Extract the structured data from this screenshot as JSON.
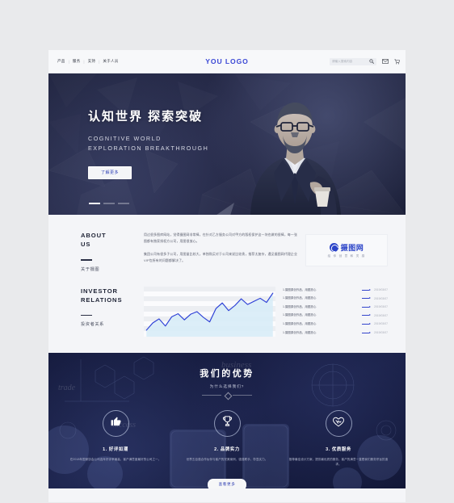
{
  "nav": {
    "links": [
      "产品",
      "服务",
      "支持",
      "关于人员"
    ],
    "logo": "YOU LOGO",
    "search_placeholder": "请输入搜索内容",
    "icons": {
      "search": "search-icon",
      "mail": "mail-icon",
      "cart": "cart-icon"
    }
  },
  "hero": {
    "title_cn": "认知世界 探索突破",
    "title_en_line1": "COGNITIVE WORLD",
    "title_en_line2": "EXPLORATION BREAKTHROUGH",
    "button": "了解更多",
    "slides": 3,
    "active_slide": 1
  },
  "about": {
    "title_en_line1": "ABOUT",
    "title_en_line2": "US",
    "title_cn": "关于摄图",
    "paragraph1": "用过很多图库网站，觉得摄图网非常棒，在针对乙方服务公司对甲方的版权保护这一块也做的很棒，每一张图都有独家授权方公司，用图很放心。",
    "paragraph2": "集团公司有很多子公司，用图量比较大，单独购买对于公司来说比较贵，推荐太复杂，遇见摄图网代理企业VIP包所有的问题都解决了。",
    "watermark": {
      "name": "摄图网",
      "tagline": "给 你 创 意 和 灵 感"
    }
  },
  "investor": {
    "title_en_line1": "INVESTOR",
    "title_en_line2": "RELATIONS",
    "title_cn": "投资者关系",
    "chart_data": {
      "type": "line",
      "title": "",
      "xlabel": "",
      "ylabel": "",
      "x": [
        0,
        1,
        2,
        3,
        4,
        5,
        6,
        7,
        8,
        9,
        10,
        11,
        12,
        13,
        14,
        15,
        16,
        17,
        18,
        19,
        20
      ],
      "values": [
        8,
        22,
        30,
        16,
        34,
        40,
        28,
        39,
        44,
        33,
        24,
        50,
        61,
        46,
        56,
        69,
        58,
        64,
        70,
        62,
        80
      ],
      "ylim": [
        0,
        88
      ],
      "grid": true,
      "legend": "none",
      "line_color": "#2c3fd6",
      "fill_color": "#d8ecf7"
    },
    "news": [
      {
        "title": "1.摄图原创作品，用图放心",
        "date": "2019/03/07"
      },
      {
        "title": "1.摄图原创作品，用图放心",
        "date": "2019/03/07"
      },
      {
        "title": "1.摄图原创作品，用图放心",
        "date": "2019/03/07"
      },
      {
        "title": "1.摄图原创作品，用图放心",
        "date": "2019/03/07"
      },
      {
        "title": "1.摄图原创作品，用图放心",
        "date": "2019/03/07"
      },
      {
        "title": "1.摄图原创作品，用图放心",
        "date": "2019/03/07"
      }
    ]
  },
  "advantages": {
    "heading": "我们的优势",
    "subheading": "为什么选择我们?",
    "bg_words": [
      "business",
      "trade",
      "success"
    ],
    "items": [
      {
        "icon": "thumbs-up-icon",
        "title": "1. 好评如潮",
        "desc": "在2018年国家协会公司连年好评率最高，客户满意度最好的公司之一。"
      },
      {
        "icon": "trophy-icon",
        "title": "2. 品牌实力",
        "desc": "世界五百强合作伙伴与客户的完美案例，强强联手，彰显实力。"
      },
      {
        "icon": "handshake-heart-icon",
        "title": "3. 优质服务",
        "desc": "推荐最佳设计方案，提供最优质的服务，客户的满意一直是我们服务宗旨的追求。"
      }
    ],
    "more_button": "查看更多"
  },
  "colors": {
    "accent": "#2b44c8",
    "hero_bg": "#20243f",
    "advantage_bg": "#121738",
    "page_bg": "#f4f5f8",
    "canvas_bg": "#e9eaec"
  }
}
